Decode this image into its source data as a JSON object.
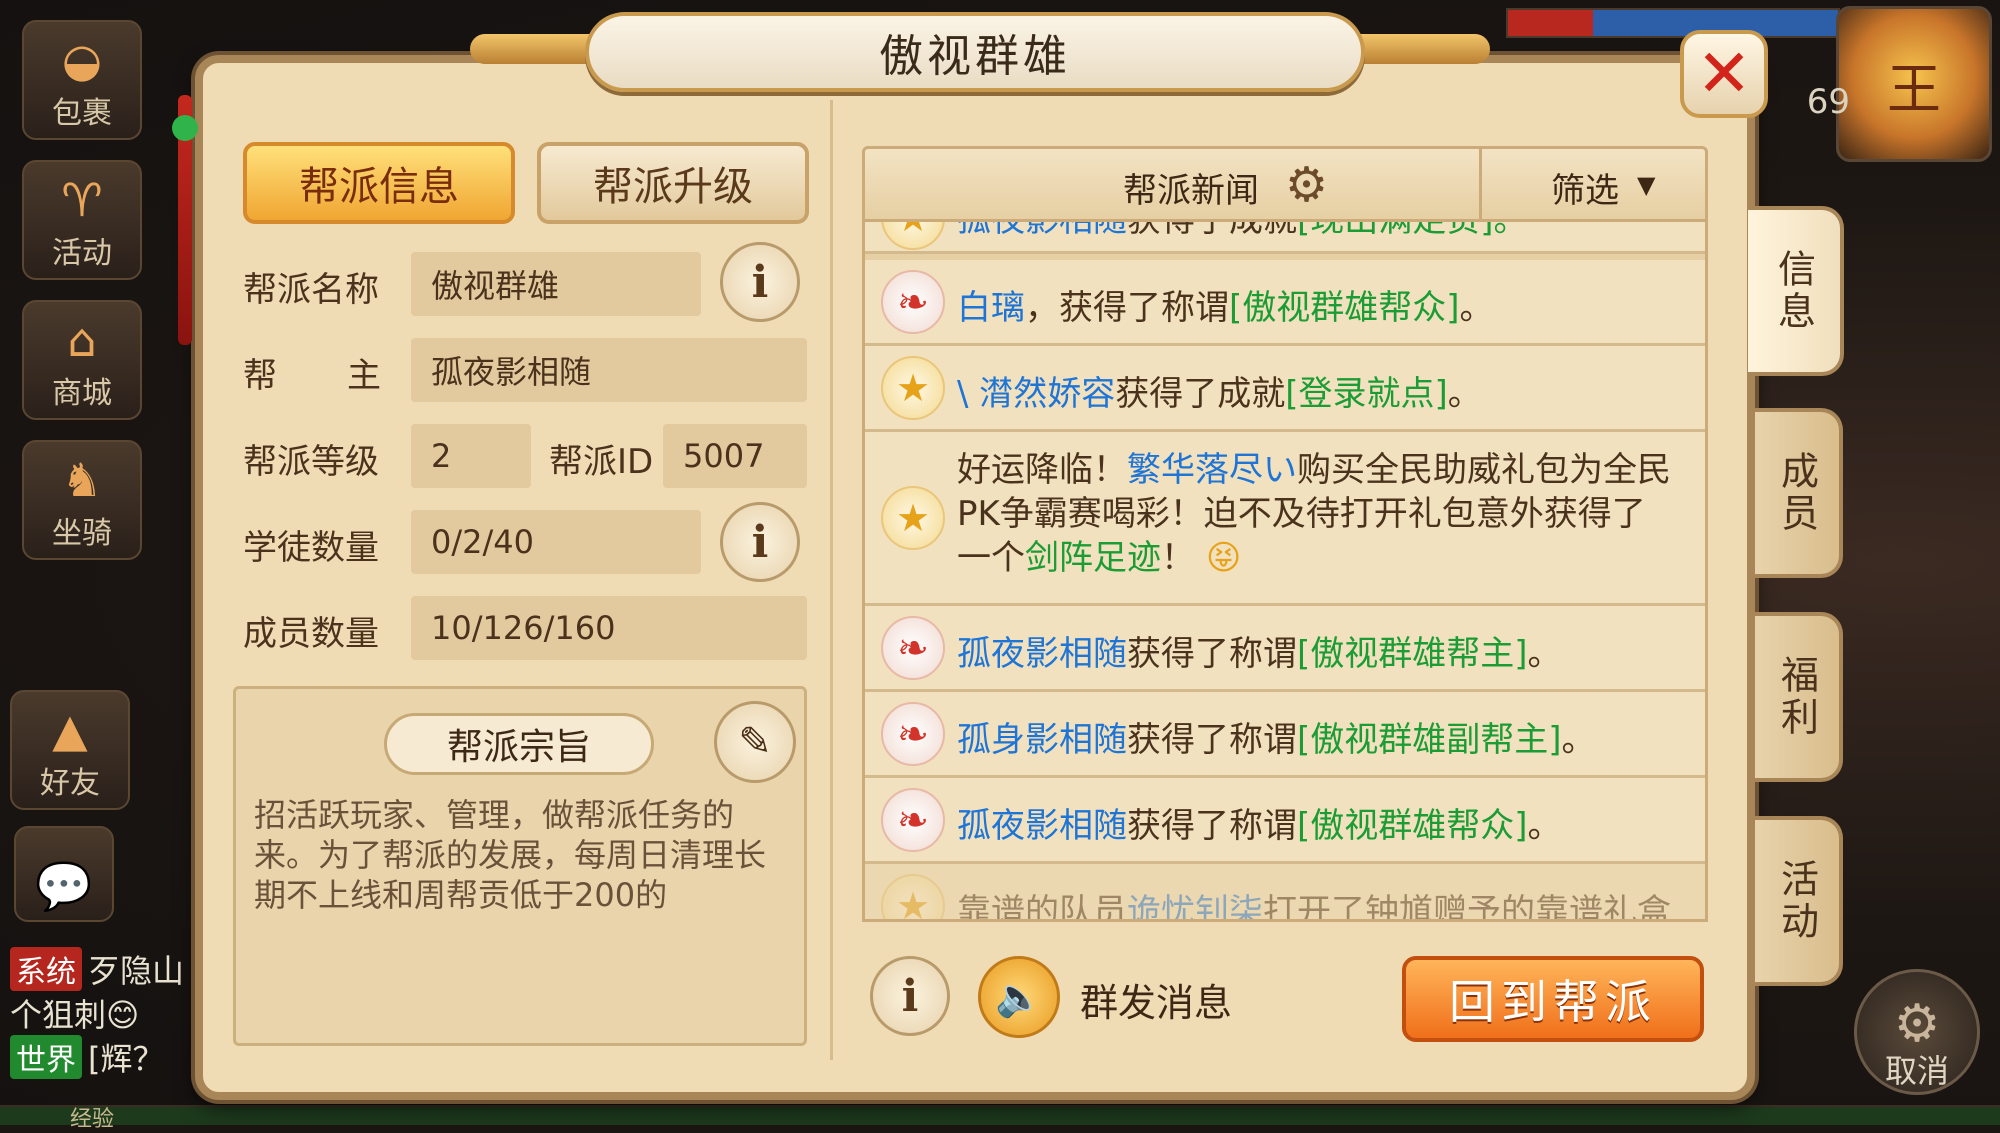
{
  "window": {
    "title": "傲视群雄",
    "close_label": "✕"
  },
  "tabs": [
    {
      "label": "帮派信息",
      "active": true
    },
    {
      "label": "帮派升级",
      "active": false
    }
  ],
  "info": {
    "name_label": "帮派名称",
    "name_value": "傲视群雄",
    "leader_label_1": "帮",
    "leader_label_2": "主",
    "leader_value": "孤夜影相随",
    "level_label": "帮派等级",
    "level_value": "2",
    "id_label": "帮派ID",
    "id_value": "5007",
    "apprentice_label": "学徒数量",
    "apprentice_value": "0/2/40",
    "member_label": "成员数量",
    "member_value": "10/126/160"
  },
  "motto": {
    "title": "帮派宗旨",
    "text": "招活跃玩家、管理，做帮派任务的来。为了帮派的发展，每周日清理长期不上线和周帮贡低于200的"
  },
  "news": {
    "title": "帮派新闻",
    "filter_label": "筛选",
    "top_partial": {
      "name": "孤夜影相随",
      "mid": "获得了成就",
      "item": "[现出满足贵]。"
    },
    "items": [
      {
        "name": "白璃",
        "mid": "，获得了称谓",
        "item": "[傲视群雄帮众]",
        "end": "。"
      },
      {
        "name": "\\ 潸然娇容",
        "mid": "获得了成就",
        "item": "[登录就点]",
        "end": "。"
      },
      {
        "prefix": "好运降临！",
        "name": "繁华落尽い",
        "mid": "购买全民助威礼包为全民PK争霸赛喝彩！迫不及待打开礼包意外获得了一个",
        "item": "剑阵足迹",
        "end": "！",
        "emoji": "😝"
      },
      {
        "name": "孤夜影相随",
        "mid": "获得了称谓",
        "item": "[傲视群雄帮主]",
        "end": "。"
      },
      {
        "name": "孤身影相随",
        "mid": "获得了称谓",
        "item": "[傲视群雄副帮主]",
        "end": "。"
      },
      {
        "name": "孤夜影相随",
        "mid": "获得了称谓",
        "item": "[傲视群雄帮众]",
        "end": "。"
      }
    ],
    "bottom_partial": {
      "prefix": "靠谱的队员",
      "name": "诡忧钊柒",
      "mid": "打开了钟馗赠予的靠谱礼盒"
    }
  },
  "bottom": {
    "broadcast_label": "群发消息",
    "return_label": "回到帮派"
  },
  "side_tabs": [
    "信息",
    "成员",
    "福利",
    "活动"
  ],
  "hud": {
    "left_buttons": [
      "包裹",
      "活动",
      "商城",
      "坐骑",
      "好友"
    ],
    "level": "69",
    "cancel_label": "取消",
    "chat": [
      {
        "tag": "系统",
        "text": "歹隐山"
      },
      {
        "tag": "",
        "text": "个狙刺😊"
      },
      {
        "tag": "世界",
        "text": "[辉？"
      }
    ],
    "xp_label": "经验"
  },
  "colors": {
    "panel": "#efdcb5",
    "accent": "#f06f1a",
    "name_blue": "#1f75d6",
    "item_green": "#1c9c34"
  }
}
